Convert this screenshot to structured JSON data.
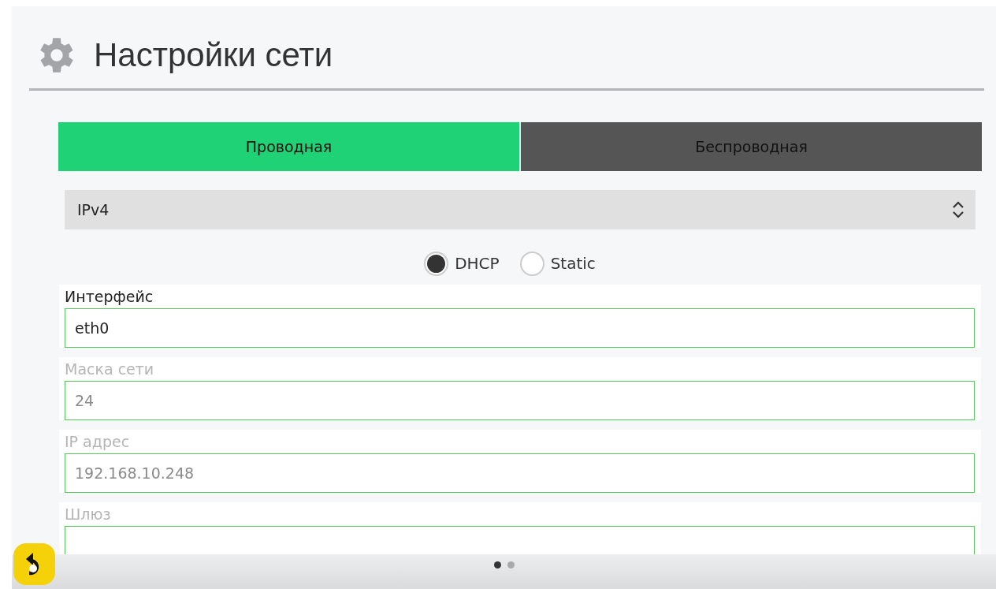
{
  "header": {
    "title": "Настройки сети"
  },
  "tabs": [
    {
      "label": "Проводная",
      "selected": true
    },
    {
      "label": "Беспроводная",
      "selected": false
    }
  ],
  "protocol_select": {
    "value": "IPv4"
  },
  "mode_radios": [
    {
      "label": "DHCP",
      "selected": true
    },
    {
      "label": "Static",
      "selected": false
    }
  ],
  "fields": [
    {
      "label": "Интерфейс",
      "value": "eth0",
      "disabled": false
    },
    {
      "label": "Маска сети",
      "value": "24",
      "disabled": true
    },
    {
      "label": "IP адрес",
      "value": "192.168.10.248",
      "disabled": true
    },
    {
      "label": "Шлюз",
      "disabled": true
    }
  ],
  "page_dots": [
    {
      "selected": true
    },
    {
      "selected": false
    }
  ]
}
